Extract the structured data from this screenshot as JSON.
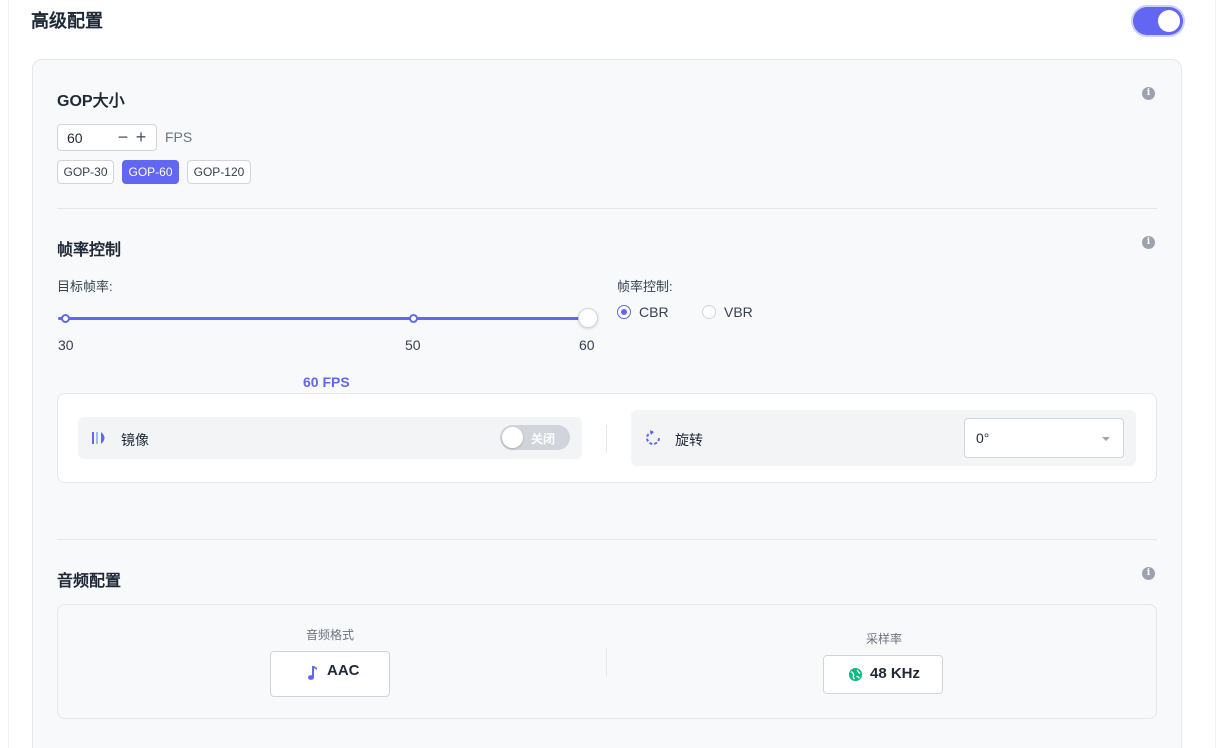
{
  "header": {
    "title": "高级配置",
    "enabled": true
  },
  "gop": {
    "title": "GOP大小",
    "value": "60",
    "minus": "−",
    "plus": "+",
    "unit": "FPS",
    "presets": [
      "GOP-30",
      "GOP-60",
      "GOP-120"
    ],
    "active_preset": "GOP-60"
  },
  "framerate": {
    "title": "帧率控制",
    "target_label": "目标帧率:",
    "slider_ticks": [
      "30",
      "50",
      "60"
    ],
    "slider_value": 60,
    "slider_value_label": "60 FPS",
    "mode_label": "帧率控制:",
    "modes": [
      "CBR",
      "VBR"
    ],
    "selected_mode": "CBR",
    "mirror_label": "镜像",
    "mirror_switch_text": "关闭",
    "mirror_on": false,
    "rotate_label": "旋转",
    "rotate_value": "0°"
  },
  "audio": {
    "title": "音频配置",
    "format_label": "音频格式",
    "format_value": "AAC",
    "samplerate_label": "采样率",
    "samplerate_value": "48 KHz"
  },
  "info_glyph": "i",
  "colors": {
    "accent": "#6366f1",
    "globe": "#10b981"
  }
}
